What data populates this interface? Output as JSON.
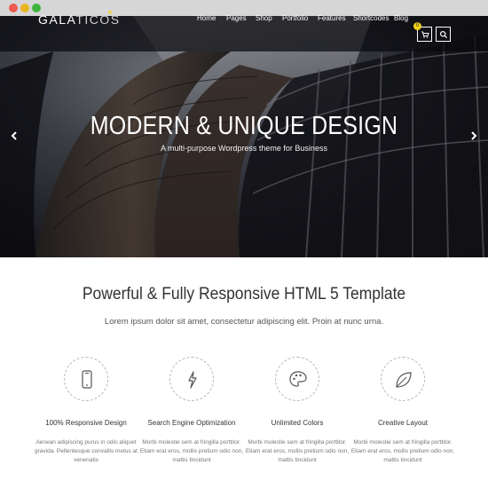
{
  "brand": {
    "logo_bold": "GALA",
    "logo_thin": "TICOS",
    "accent_color": "#f3d21c"
  },
  "nav": {
    "items": [
      "Home",
      "Pages",
      "Shop",
      "Portfolio",
      "Features",
      "Shortcodes",
      "Blog"
    ],
    "cart_icon": "cart-icon",
    "cart_count": "0",
    "search_icon": "search-icon"
  },
  "hero": {
    "title": "MODERN & UNIQUE DESIGN",
    "subtitle": "A multi-purpose Wordpress theme for Business",
    "prev_icon": "chevron-left-icon",
    "next_icon": "chevron-right-icon"
  },
  "intro": {
    "title": "Powerful & Fully Responsive HTML 5 Template",
    "subtitle": "Lorem ipsum dolor sit amet, consectetur adipiscing elit. Proin at nunc urna."
  },
  "features": [
    {
      "icon": "mobile-phone-icon",
      "title": "100% Responsive Design",
      "desc": "Aenean adipiscing purus in odio aliquet gravida. Pellentesque convallis metus at venenatis"
    },
    {
      "icon": "lightning-icon",
      "title": "Search Engine Optimization",
      "desc": "Morbi molestie sem at fringilla porttitor. Etiam erat eros, mollis pretium odio non, mattis tincidunt"
    },
    {
      "icon": "palette-icon",
      "title": "Unlimited Colors",
      "desc": "Morbi molestie sem at fringilla porttitor. Etiam erat eros, mollis pretium odio non, mattis tincidunt"
    },
    {
      "icon": "leaf-icon",
      "title": "Creative Layout",
      "desc": "Morbi molestie sem at fringilla porttitor. Etiam erat eros, mollis pretium odio non, mattis tincidunt"
    }
  ]
}
